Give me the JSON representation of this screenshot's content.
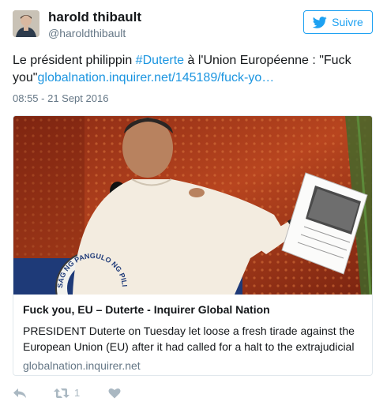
{
  "user": {
    "display_name": "harold thibault",
    "handle": "@haroldthibault",
    "avatar_icon": "profile-photo"
  },
  "follow_button": {
    "label": "Suivre",
    "icon": "twitter-bird-icon"
  },
  "tweet": {
    "text_before": "Le président philippin ",
    "hashtag": "#Duterte",
    "text_middle": " à l'Union Européenne : \"Fuck you\"",
    "link": "globalnation.inquirer.net/145189/fuck-yo…",
    "timestamp": "08:55 - 21 Sept 2016"
  },
  "card": {
    "title": "Fuck you, EU – Duterte - Inquirer Global Nation",
    "description": "PRESIDENT Duterte on Tuesday let loose a fresh tirade against the European Union (EU) after it had called for a halt to the extrajudicial",
    "domain": "globalnation.inquirer.net",
    "seal_text": "SAG NG PANGULO NG PILI"
  },
  "actions": {
    "reply_icon": "reply-icon",
    "retweet_icon": "retweet-icon",
    "retweet_count": "1",
    "like_icon": "heart-icon"
  },
  "colors": {
    "accent": "#1da1f2",
    "link": "#1b95e0",
    "muted": "#657786",
    "border": "#e1e8ed",
    "action_icon": "#aab8c2"
  }
}
